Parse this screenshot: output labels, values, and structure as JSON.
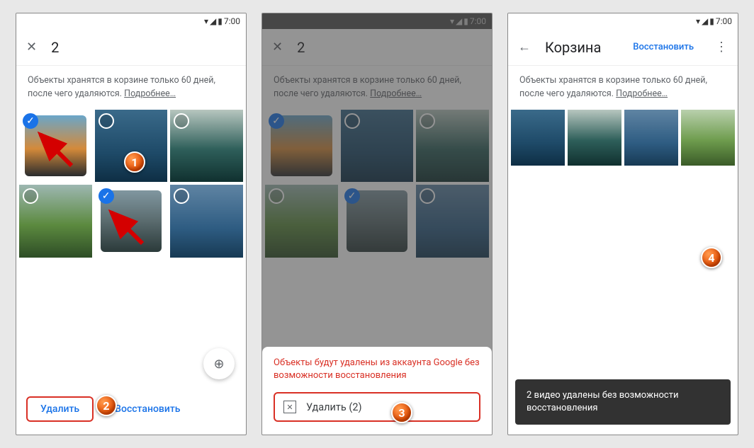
{
  "status": {
    "time": "7:00"
  },
  "screen1": {
    "selection_count": "2",
    "info": "Объекты хранятся в корзине только 60 дней, после чего удаляются.",
    "info_more": "Подробнее…",
    "delete": "Удалить",
    "restore": "Восстановить"
  },
  "screen2": {
    "warning": "Объекты будут удалены из аккаунта Google без возможности восстановления",
    "delete_action": "Удалить (2)"
  },
  "screen3": {
    "title": "Корзина",
    "restore": "Восстановить",
    "snackbar": "2 видео удалены без возможности восстановления"
  },
  "steps": {
    "s1": "1",
    "s2": "2",
    "s3": "3",
    "s4": "4"
  }
}
